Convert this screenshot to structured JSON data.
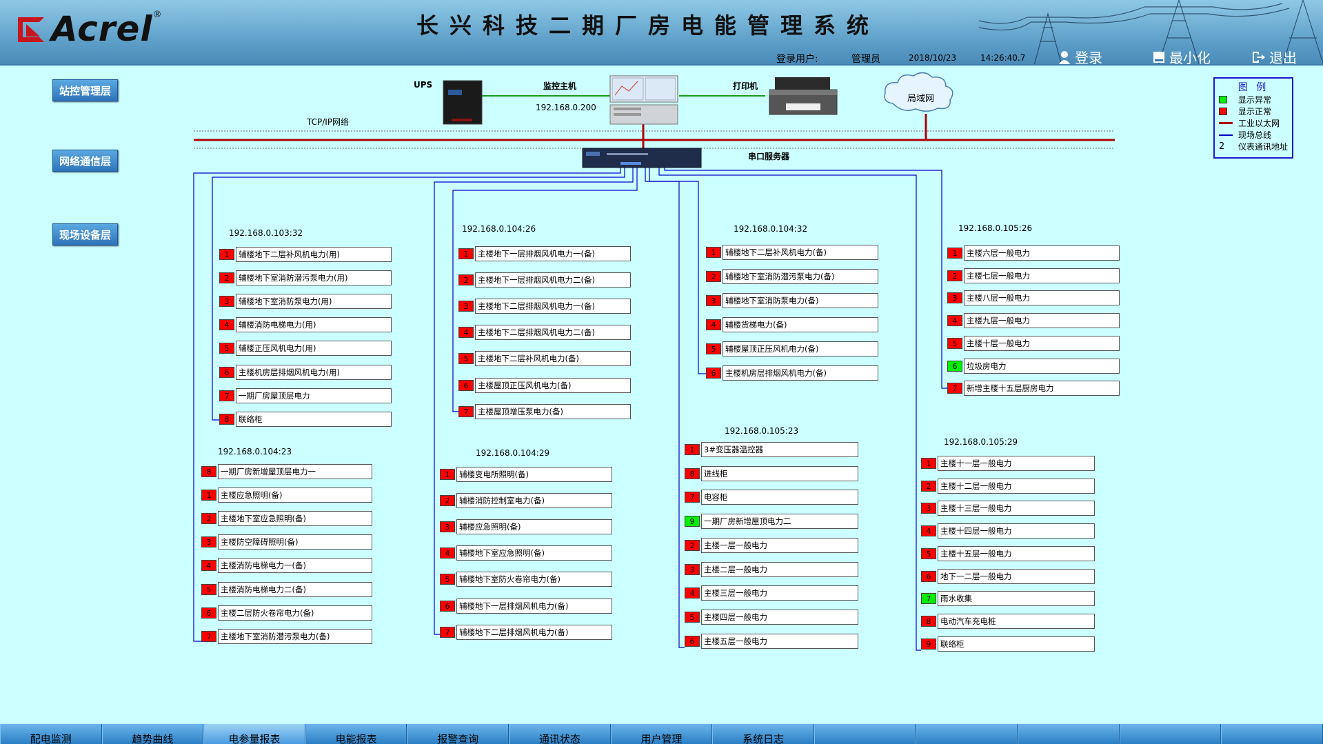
{
  "header": {
    "logo_text": "Acrel",
    "logo_reg": "®",
    "title": "长兴科技二期厂房电能管理系统",
    "login_label": "登录用户:",
    "user": "管理员",
    "date": "2018/10/23",
    "time": "14:26:40.7",
    "btn_login": "登录",
    "btn_minimize": "最小化",
    "btn_exit": "退出"
  },
  "layers": {
    "station": "站控管理层",
    "network": "网络通信层",
    "field": "现场设备层"
  },
  "topology": {
    "ups": "UPS",
    "host": "监控主机",
    "host_ip": "192.168.0.200",
    "printer": "打印机",
    "lan": "局域网",
    "tcpip": "TCP/IP网络",
    "serial_server": "串口服务器"
  },
  "legend": {
    "title": "图 例",
    "abnormal": "显示异常",
    "normal": "显示正常",
    "ethernet": "工业以太网",
    "bus": "现场总线",
    "addr_num": "2",
    "addr": "仪表通讯地址",
    "color_abnormal": "#00ee00",
    "color_normal": "#ff0000"
  },
  "groups": [
    {
      "ip": "192.168.0.103:32",
      "devices": [
        {
          "n": "1",
          "label": "辅楼地下二层补风机电力(用)",
          "status": "red"
        },
        {
          "n": "2",
          "label": "辅楼地下室消防潜污泵电力(用)",
          "status": "red"
        },
        {
          "n": "3",
          "label": "辅楼地下室消防泵电力(用)",
          "status": "red"
        },
        {
          "n": "4",
          "label": "辅楼消防电梯电力(用)",
          "status": "red"
        },
        {
          "n": "5",
          "label": "辅楼正压风机电力(用)",
          "status": "red"
        },
        {
          "n": "6",
          "label": "主楼机房层排烟风机电力(用)",
          "status": "red"
        },
        {
          "n": "7",
          "label": "一期厂房屋顶层电力",
          "status": "red"
        },
        {
          "n": "8",
          "label": "联络柜",
          "status": "red"
        }
      ]
    },
    {
      "ip": "192.168.0.104:26",
      "devices": [
        {
          "n": "1",
          "label": "主楼地下一层排烟风机电力一(备)",
          "status": "red"
        },
        {
          "n": "2",
          "label": "主楼地下一层排烟风机电力二(备)",
          "status": "red"
        },
        {
          "n": "3",
          "label": "主楼地下二层排烟风机电力一(备)",
          "status": "red"
        },
        {
          "n": "4",
          "label": "主楼地下二层排烟风机电力二(备)",
          "status": "red"
        },
        {
          "n": "5",
          "label": "主楼地下二层补风机电力(备)",
          "status": "red"
        },
        {
          "n": "6",
          "label": "主楼屋顶正压风机电力(备)",
          "status": "red"
        },
        {
          "n": "7",
          "label": "主楼屋顶增压泵电力(备)",
          "status": "red"
        }
      ]
    },
    {
      "ip": "192.168.0.104:32",
      "devices": [
        {
          "n": "1",
          "label": "辅楼地下二层补风机电力(备)",
          "status": "red"
        },
        {
          "n": "2",
          "label": "辅楼地下室消防潜污泵电力(备)",
          "status": "red"
        },
        {
          "n": "3",
          "label": "辅楼地下室消防泵电力(备)",
          "status": "red"
        },
        {
          "n": "4",
          "label": "辅楼货梯电力(备)",
          "status": "red"
        },
        {
          "n": "5",
          "label": "辅楼屋顶正压风机电力(备)",
          "status": "red"
        },
        {
          "n": "6",
          "label": "主楼机房层排烟风机电力(备)",
          "status": "red"
        }
      ]
    },
    {
      "ip": "192.168.0.105:26",
      "devices": [
        {
          "n": "1",
          "label": "主楼六层一般电力",
          "status": "red"
        },
        {
          "n": "2",
          "label": "主楼七层一般电力",
          "status": "red"
        },
        {
          "n": "3",
          "label": "主楼八层一般电力",
          "status": "red"
        },
        {
          "n": "4",
          "label": "主楼九层一般电力",
          "status": "red"
        },
        {
          "n": "5",
          "label": "主楼十层一般电力",
          "status": "red"
        },
        {
          "n": "6",
          "label": "垃圾房电力",
          "status": "green"
        },
        {
          "n": "7",
          "label": "新增主楼十五层厨房电力",
          "status": "red"
        }
      ]
    },
    {
      "ip": "192.168.0.104:23",
      "devices": [
        {
          "n": "8",
          "label": "一期厂房新增屋顶层电力一",
          "status": "red"
        },
        {
          "n": "1",
          "label": "主楼应急照明(备)",
          "status": "red"
        },
        {
          "n": "2",
          "label": "主楼地下室应急照明(备)",
          "status": "red"
        },
        {
          "n": "3",
          "label": "主楼防空障碍照明(备)",
          "status": "red"
        },
        {
          "n": "4",
          "label": "主楼消防电梯电力一(备)",
          "status": "red"
        },
        {
          "n": "5",
          "label": "主楼消防电梯电力二(备)",
          "status": "red"
        },
        {
          "n": "6",
          "label": "主楼二层防火卷帘电力(备)",
          "status": "red"
        },
        {
          "n": "7",
          "label": "主楼地下室消防潜污泵电力(备)",
          "status": "red"
        }
      ]
    },
    {
      "ip": "192.168.0.104:29",
      "devices": [
        {
          "n": "1",
          "label": "辅楼变电所照明(备)",
          "status": "red"
        },
        {
          "n": "2",
          "label": "辅楼消防控制室电力(备)",
          "status": "red"
        },
        {
          "n": "3",
          "label": "辅楼应急照明(备)",
          "status": "red"
        },
        {
          "n": "4",
          "label": "辅楼地下室应急照明(备)",
          "status": "red"
        },
        {
          "n": "5",
          "label": "辅楼地下室防火卷帘电力(备)",
          "status": "red"
        },
        {
          "n": "6",
          "label": "辅楼地下一层排烟风机电力(备)",
          "status": "red"
        },
        {
          "n": "7",
          "label": "辅楼地下二层排烟风机电力(备)",
          "status": "red"
        }
      ]
    },
    {
      "ip": "192.168.0.105:23",
      "devices": [
        {
          "n": "1",
          "label": "3#变压器温控器",
          "status": "red"
        },
        {
          "n": "8",
          "label": "进线柜",
          "status": "red"
        },
        {
          "n": "7",
          "label": "电容柜",
          "status": "red"
        },
        {
          "n": "9",
          "label": "一期厂房新增屋顶电力二",
          "status": "green"
        },
        {
          "n": "2",
          "label": "主楼一层一般电力",
          "status": "red"
        },
        {
          "n": "3",
          "label": "主楼二层一般电力",
          "status": "red"
        },
        {
          "n": "4",
          "label": "主楼三层一般电力",
          "status": "red"
        },
        {
          "n": "5",
          "label": "主楼四层一般电力",
          "status": "red"
        },
        {
          "n": "6",
          "label": "主楼五层一般电力",
          "status": "red"
        }
      ]
    },
    {
      "ip": "192.168.0.105:29",
      "devices": [
        {
          "n": "1",
          "label": "主楼十一层一般电力",
          "status": "red"
        },
        {
          "n": "2",
          "label": "主楼十二层一般电力",
          "status": "red"
        },
        {
          "n": "3",
          "label": "主楼十三层一般电力",
          "status": "red"
        },
        {
          "n": "4",
          "label": "主楼十四层一般电力",
          "status": "red"
        },
        {
          "n": "5",
          "label": "主楼十五层一般电力",
          "status": "red"
        },
        {
          "n": "6",
          "label": "地下一二层一般电力",
          "status": "red"
        },
        {
          "n": "7",
          "label": "雨水收集",
          "status": "green"
        },
        {
          "n": "8",
          "label": "电动汽车充电桩",
          "status": "red"
        },
        {
          "n": "9",
          "label": "联络柜",
          "status": "red"
        }
      ]
    }
  ],
  "tabs": [
    "配电监测",
    "趋势曲线",
    "电参量报表",
    "电能报表",
    "报警查询",
    "通讯状态",
    "用户管理",
    "系统日志",
    "",
    "",
    "",
    "",
    ""
  ]
}
